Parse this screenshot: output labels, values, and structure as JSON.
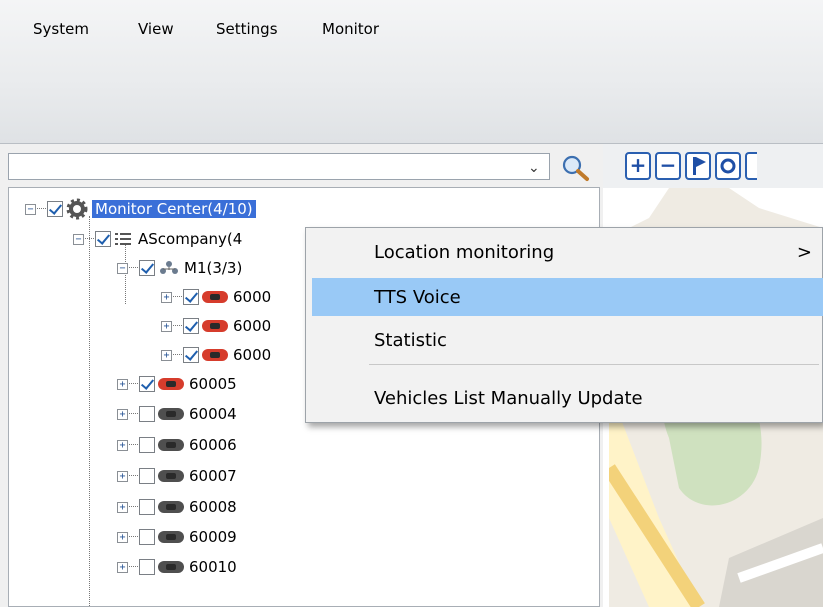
{
  "menubar": {
    "items": [
      "System",
      "View",
      "Settings",
      "Monitor"
    ]
  },
  "search": {
    "value": "",
    "placeholder": ""
  },
  "tree": {
    "root": {
      "label": "Monitor Center(4/10)"
    },
    "company": {
      "label": "AScompany(4"
    },
    "group": {
      "label": "M1(3/3)"
    },
    "vehicles": [
      {
        "label": "6000",
        "checked": true,
        "status": "online"
      },
      {
        "label": "6000",
        "checked": true,
        "status": "online"
      },
      {
        "label": "6000",
        "checked": true,
        "status": "online"
      },
      {
        "label": "60005",
        "checked": true,
        "status": "online"
      },
      {
        "label": "60004",
        "checked": false,
        "status": "offline"
      },
      {
        "label": "60006",
        "checked": false,
        "status": "offline"
      },
      {
        "label": "60007",
        "checked": false,
        "status": "offline"
      },
      {
        "label": "60008",
        "checked": false,
        "status": "offline"
      },
      {
        "label": "60009",
        "checked": false,
        "status": "offline"
      },
      {
        "label": "60010",
        "checked": false,
        "status": "offline"
      }
    ]
  },
  "map_toolbar": {
    "buttons": [
      "zoom-in",
      "zoom-out",
      "flag",
      "circle",
      "more"
    ]
  },
  "context_menu": {
    "items": [
      {
        "label": "Location monitoring",
        "submenu": ">"
      },
      {
        "label": "TTS Voice",
        "highlighted": true
      },
      {
        "label": "Statistic"
      },
      {
        "label": "Vehicles List Manually Update"
      }
    ]
  },
  "colors": {
    "selection": "#3a6fd8",
    "menu_highlight": "#99c9f6",
    "vehicle_online": "#d63c2c",
    "vehicle_offline": "#4f4f4f"
  }
}
